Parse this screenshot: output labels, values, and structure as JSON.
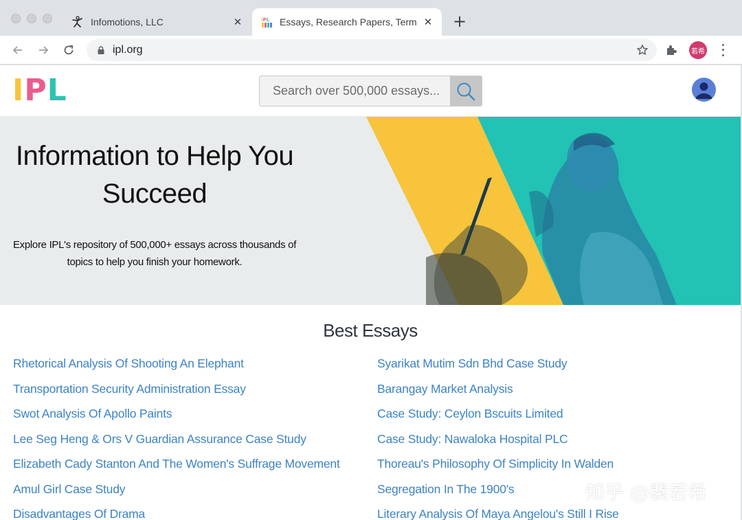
{
  "browser": {
    "tabs": [
      {
        "title": "Infomotions, LLC",
        "active": false
      },
      {
        "title": "Essays, Research Papers, Term",
        "active": true
      }
    ],
    "address": "ipl.org",
    "profile_initials": "若希"
  },
  "site": {
    "logo": {
      "letters": [
        "I",
        "P",
        "L"
      ],
      "colors": [
        "#f7c43b",
        "#ec5b8e",
        "#2cc3b1"
      ]
    },
    "search": {
      "placeholder": "Search over 500,000 essays..."
    }
  },
  "hero": {
    "title": "Information to Help You Succeed",
    "subtitle": "Explore IPL's repository of 500,000+ essays across thousands of topics to help you finish your homework."
  },
  "best_essays": {
    "heading": "Best Essays",
    "left": [
      "Rhetorical Analysis Of Shooting An Elephant",
      "Transportation Security Administration Essay",
      "Swot Analysis Of Apollo Paints",
      "Lee Seg Heng & Ors V Guardian Assurance Case Study",
      "Elizabeth Cady Stanton And The Women's Suffrage Movement",
      "Amul Girl Case Study",
      "Disadvantages Of Drama"
    ],
    "right": [
      "Syarikat Mutim Sdn Bhd Case Study",
      "Barangay Market Analysis",
      "Case Study: Ceylon Bscuits Limited",
      "Case Study: Nawaloka Hospital PLC",
      "Thoreau's Philosophy Of Simplicity In Walden",
      "Segregation In The 1900's",
      "Literary Analysis Of Maya Angelou's Still I Rise"
    ]
  },
  "watermark": "知乎 @裴若希",
  "colors": {
    "link": "#3d83c5",
    "hero_yellow": "#f7c43b",
    "hero_teal": "#22c2b4"
  }
}
